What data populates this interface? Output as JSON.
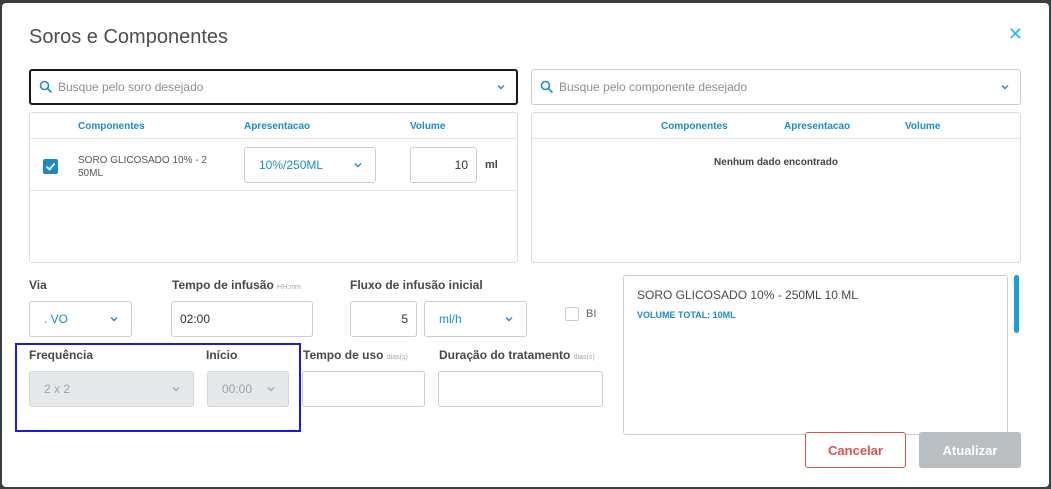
{
  "dialog": {
    "title": "Soros e Componentes",
    "close_icon": "close-icon"
  },
  "search_soro": {
    "placeholder": "Busque pelo soro desejado"
  },
  "search_componente": {
    "placeholder": "Busque pelo componente desejado"
  },
  "left_grid": {
    "headers": [
      "Componentes",
      "Apresentacao",
      "Volume"
    ],
    "rows": [
      {
        "checked": true,
        "componente_line1": "SORO GLICOSADO 10% - 2",
        "componente_line2": "50ML",
        "apresentacao": "10%/250ML",
        "volume": "10",
        "unit": "ml"
      }
    ]
  },
  "right_grid": {
    "headers": [
      "Componentes",
      "Apresentacao",
      "Volume"
    ],
    "empty_message": "Nenhum dado encontrado"
  },
  "form": {
    "via_label": "Via",
    "via_value": ". VO",
    "tempo_infusao_label": "Tempo de infusão",
    "tempo_infusao_hint": "HH:mm",
    "tempo_infusao_value": "02:00",
    "fluxo_label": "Fluxo de infusão inicial",
    "fluxo_value": "5",
    "fluxo_unit": "ml/h",
    "bi_label": "BI",
    "frequencia_label": "Frequência",
    "frequencia_value": "2 x 2",
    "inicio_label": "Início",
    "inicio_value": "00:00",
    "tempo_uso_label": "Tempo de uso",
    "tempo_uso_hint": "dias(s)",
    "tempo_uso_value": "",
    "duracao_label": "Duração do tratamento",
    "duracao_hint": "dias(s)",
    "duracao_value": ""
  },
  "summary": {
    "line1": "SORO GLICOSADO 10% - 250ML 10 ML",
    "line2": "VOLUME TOTAL: 10ML"
  },
  "buttons": {
    "cancel": "Cancelar",
    "update": "Atualizar"
  },
  "colors": {
    "accent": "#1f8bc8",
    "cancel_border": "#d9534f",
    "update_bg": "#b9bec3",
    "highlight": "#1b1bd9"
  }
}
